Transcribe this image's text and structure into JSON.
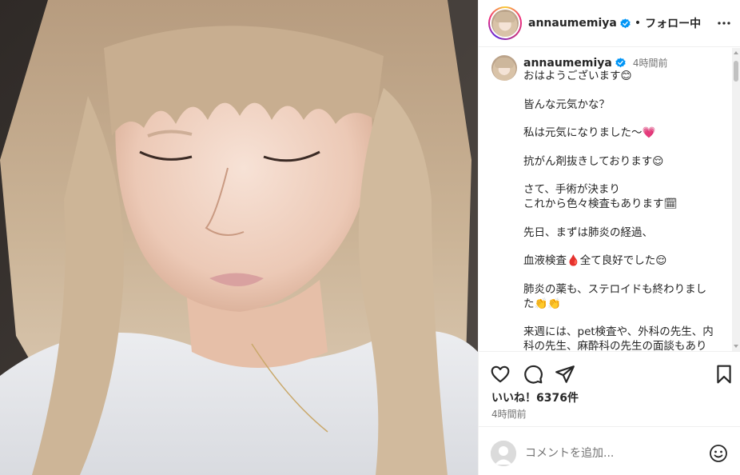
{
  "post": {
    "username": "annaumemiya",
    "separator": "•",
    "follow_status": "フォロー中",
    "caption_time": "4時間前",
    "caption_lines": [
      "おはようございます😊",
      "",
      "皆んな元気かな？",
      "",
      "私は元気になりました〜💗",
      "",
      "抗がん剤抜きしております😌",
      "",
      "さて、手術が決まり",
      "これから色々検査もあります🗓",
      "",
      "先日、まずは肺炎の経過、",
      "",
      "血液検査🩸全て良好でした😌",
      "",
      "肺炎の薬も、ステロイドも終わりまし",
      "た👏👏",
      "",
      "来週には、pet検査や、外科の先生、内",
      "科の先生、麻酔科の先生の面談もあり"
    ],
    "likes": "いいね！6376件",
    "posted_time": "4時間前"
  },
  "comment": {
    "placeholder": "コメントを追加..."
  },
  "icons": {
    "verified": "verified-badge-icon",
    "more": "more-options-icon",
    "like": "heart-icon",
    "comment": "comment-icon",
    "share": "share-icon",
    "save": "bookmark-icon",
    "emoji": "emoji-icon"
  },
  "colors": {
    "verified_blue": "#0095f6",
    "text": "#262626",
    "muted": "#737373"
  }
}
